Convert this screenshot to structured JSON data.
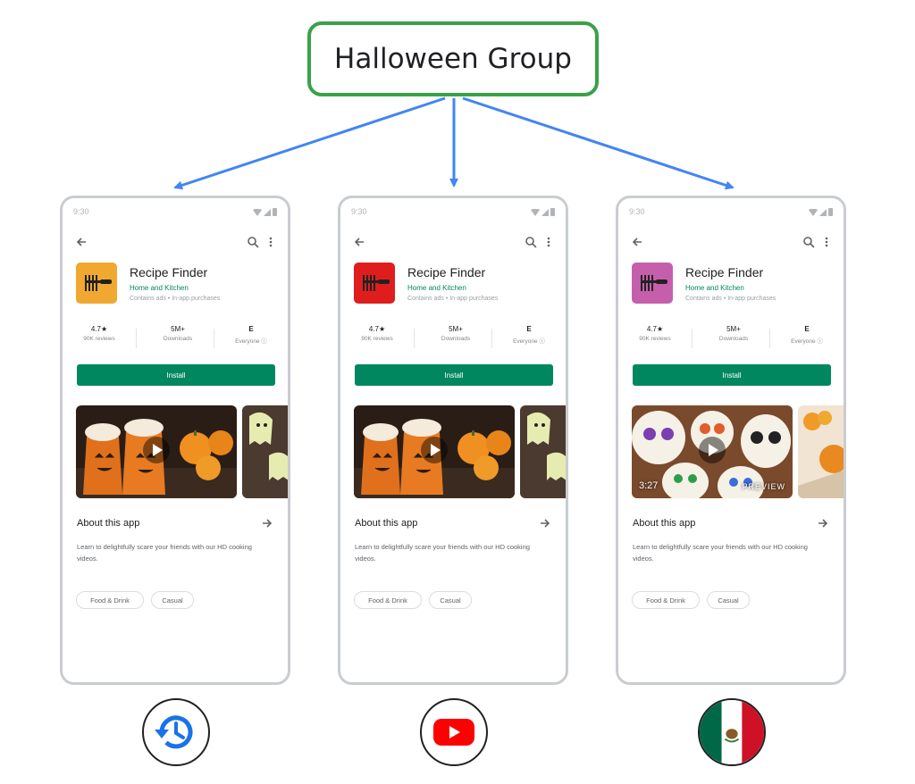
{
  "diagram": {
    "group_label": "Halloween Group",
    "colors": {
      "group_border": "#3aa148",
      "arrow": "#4285f4",
      "install": "#01875f",
      "category": "#01875f"
    }
  },
  "phones": [
    {
      "time": "9:30",
      "icon_color": "#f0a830",
      "app_name": "Recipe Finder",
      "category": "Home and Kitchen",
      "meta": "Contains ads  •  In-app purchases",
      "rating": "4.7★",
      "reviews": "90K reviews",
      "downloads": "5M+",
      "downloads_label": "Downloads",
      "content_rating": "E",
      "content_label": "Everyone ⓘ",
      "install": "Install",
      "media_theme": "halloween-drinks",
      "duration": "",
      "preview": "",
      "about_title": "About this app",
      "about_desc": "Learn to delightfully scare your friends with our HD cooking videos.",
      "tags": [
        "Food & Drink",
        "Casual"
      ],
      "source_icon": "history-icon"
    },
    {
      "time": "9:30",
      "icon_color": "#e01d1d",
      "app_name": "Recipe Finder",
      "category": "Home and Kitchen",
      "meta": "Contains ads  •  In-app purchases",
      "rating": "4.7★",
      "reviews": "90K reviews",
      "downloads": "5M+",
      "downloads_label": "Downloads",
      "content_rating": "E",
      "content_label": "Everyone ⓘ",
      "install": "Install",
      "media_theme": "halloween-drinks",
      "duration": "",
      "preview": "",
      "about_title": "About this app",
      "about_desc": "Learn to delightfully scare your friends with our HD cooking videos.",
      "tags": [
        "Food & Drink",
        "Casual"
      ],
      "source_icon": "youtube-icon"
    },
    {
      "time": "9:30",
      "icon_color": "#c65fab",
      "app_name": "Recipe Finder",
      "category": "Home and Kitchen",
      "meta": "Contains ads  •  In-app purchases",
      "rating": "4.7★",
      "reviews": "90K reviews",
      "downloads": "5M+",
      "downloads_label": "Downloads",
      "content_rating": "E",
      "content_label": "Everyone ⓘ",
      "install": "Install",
      "media_theme": "sugar-skull-cookies",
      "duration": "3:27",
      "preview": "PREVIEW",
      "about_title": "About this app",
      "about_desc": "Learn to delightfully scare your friends with our HD cooking videos.",
      "tags": [
        "Food & Drink",
        "Casual"
      ],
      "source_icon": "mexico-flag-icon"
    }
  ]
}
